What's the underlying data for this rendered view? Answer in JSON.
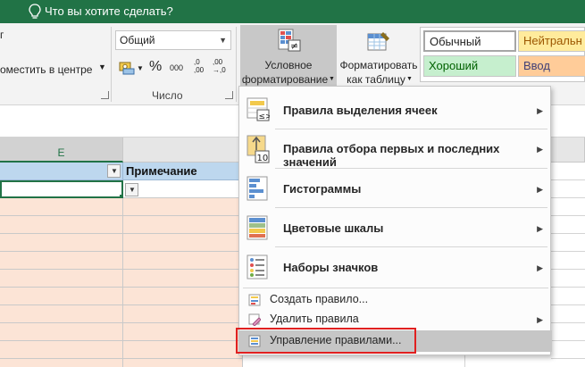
{
  "tellme": {
    "text": "Что вы хотите сделать?"
  },
  "ribbon": {
    "left_fragment": "г",
    "merge_center": "оместить в центре",
    "number_format": "Общий",
    "percent": "%",
    "thousands": "000",
    "inc_decimal": ",0\n,00",
    "dec_decimal": ",00\n→,0",
    "group_number": "Число",
    "conditional_formatting": {
      "line1": "Условное",
      "line2": "форматирование"
    },
    "format_as_table": {
      "line1": "Форматировать",
      "line2": "как таблицу"
    },
    "styles": {
      "normal": "Обычный",
      "neutral": "Нейтральн",
      "good": "Хороший",
      "input": "Ввод"
    }
  },
  "sheet": {
    "col_e": "E",
    "header_note": "Примечание"
  },
  "menu": {
    "items": [
      {
        "label": "Правила выделения ячеек",
        "submenu": true
      },
      {
        "label": "Правила отбора первых и последних значений",
        "submenu": true
      },
      {
        "label": "Гистограммы",
        "submenu": true
      },
      {
        "label": "Цветовые шкалы",
        "submenu": true
      },
      {
        "label": "Наборы значков",
        "submenu": true
      },
      {
        "label": "Создать правило...",
        "submenu": false
      },
      {
        "label": "Удалить правила",
        "submenu": true
      },
      {
        "label": "Управление правилами...",
        "submenu": false
      }
    ],
    "submenu_arrow": "▶"
  },
  "colors": {
    "excel_green": "#217346",
    "pink_cell": "#fce4d6",
    "header_blue": "#bdd7ee",
    "good_green": "#c6efce",
    "good_text": "#006100",
    "neutral_yellow": "#ffeb9c",
    "neutral_text": "#9c5700",
    "input_orange": "#ffcc99",
    "highlight_red": "#e02020"
  }
}
